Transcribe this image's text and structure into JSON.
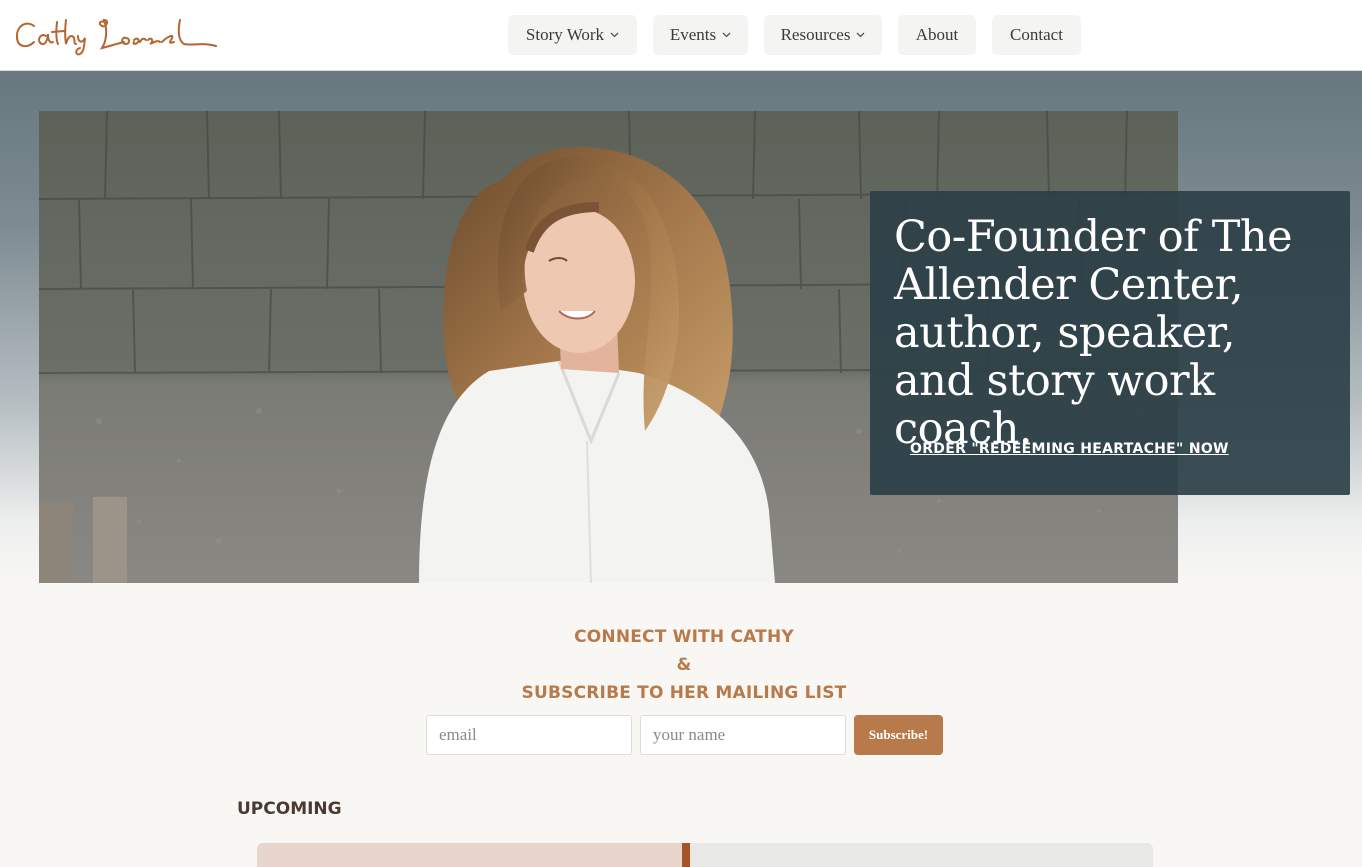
{
  "header": {
    "logo_text": "Cathy Loerzel",
    "nav": [
      {
        "label": "Story Work",
        "has_dropdown": true
      },
      {
        "label": "Events",
        "has_dropdown": true
      },
      {
        "label": "Resources",
        "has_dropdown": true
      },
      {
        "label": "About",
        "has_dropdown": false
      },
      {
        "label": "Contact",
        "has_dropdown": false
      }
    ],
    "dropdown_glyph": "⌄"
  },
  "hero": {
    "heading": "Co-Founder of The Allender Center, author, speaker, and story work coach.",
    "cta_label": "ORDER \"REDEEMING HEARTACHE\" NOW"
  },
  "connect": {
    "line1": "CONNECT WITH CATHY",
    "line2": "&",
    "line3": "SUBSCRIBE TO HER MAILING LIST",
    "email_placeholder": "email",
    "name_placeholder": "your name",
    "subscribe_label": "Subscribe!"
  },
  "upcoming": {
    "title": "UPCOMING"
  },
  "colors": {
    "accent": "#b87a4b",
    "overlay": "#2c4048",
    "logo": "#b5652f"
  }
}
